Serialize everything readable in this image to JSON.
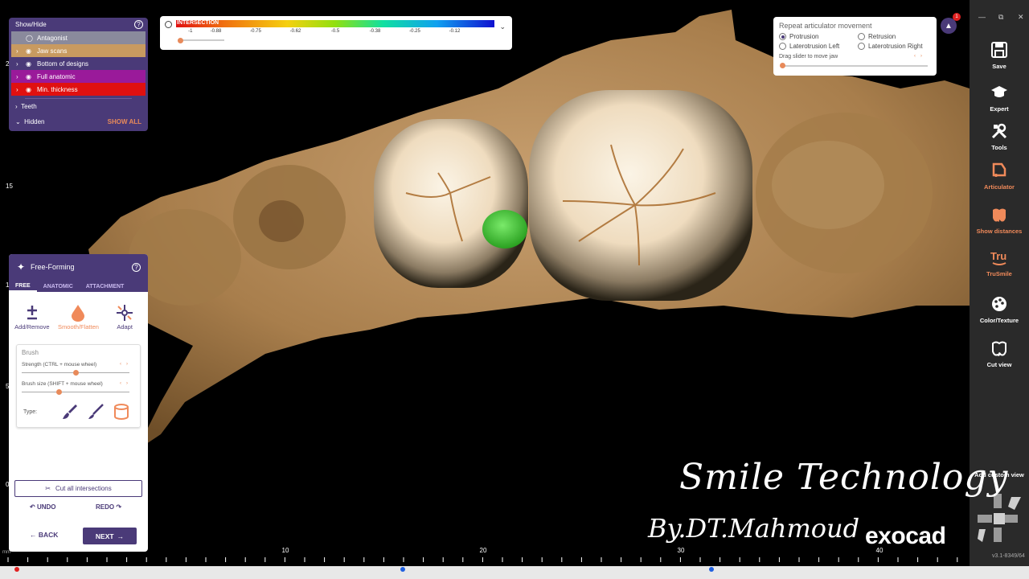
{
  "colors": {
    "panel_purple": "#4a3a78",
    "accent_orange": "#f08a5a",
    "antagonist_row": "#8a8a9c",
    "jaw_scans_row": "#c89a60",
    "full_anatomic_row": "#9a1a9a",
    "min_thickness_row": "#e01010",
    "intersection_highlight": "#3cc030"
  },
  "show_hide": {
    "title": "Show/Hide",
    "items": [
      {
        "label": "Antagonist"
      },
      {
        "label": "Jaw scans"
      },
      {
        "label": "Bottom of designs"
      },
      {
        "label": "Full anatomic"
      },
      {
        "label": "Min. thickness"
      }
    ],
    "teeth_label": "Teeth",
    "hidden_label": "Hidden",
    "show_all_label": "SHOW ALL"
  },
  "intersection": {
    "title": "INTERSECTION",
    "ticks": [
      "-1",
      "-0.88",
      "-0.75",
      "-0.62",
      "-0.5",
      "-0.38",
      "-0.25",
      "-0.12"
    ],
    "slider_value": 0.05
  },
  "articulator": {
    "title": "Repeat articulator movement",
    "options": [
      {
        "label": "Protrusion",
        "selected": true
      },
      {
        "label": "Retrusion",
        "selected": false
      },
      {
        "label": "Laterotrusion Left",
        "selected": false
      },
      {
        "label": "Laterotrusion Right",
        "selected": false
      }
    ],
    "drag_hint": "Drag slider to move jaw",
    "slider_value": 0.0
  },
  "notifications": {
    "count": "1"
  },
  "toolbar": {
    "items": [
      {
        "label": "Save",
        "icon": "save-icon"
      },
      {
        "label": "Expert",
        "icon": "graduation-cap-icon"
      },
      {
        "label": "Tools",
        "icon": "tools-icon"
      },
      {
        "label": "Articulator",
        "icon": "articulator-icon"
      },
      {
        "label": "Show distances",
        "icon": "distances-icon"
      },
      {
        "label": "TruSmile",
        "icon": "trusmile-icon"
      },
      {
        "label": "Color/Texture",
        "icon": "palette-icon"
      },
      {
        "label": "Cut view",
        "icon": "cut-view-icon"
      }
    ],
    "custom_view_label": "Add custom view",
    "version": "v3.1-8349/64"
  },
  "free_forming": {
    "title": "Free-Forming",
    "tabs": [
      "FREE",
      "ANATOMIC",
      "ATTACHMENT"
    ],
    "tools": [
      {
        "label": "Add/Remove"
      },
      {
        "label": "Smooth/Flatten"
      },
      {
        "label": "Adapt"
      }
    ],
    "brush_title": "Brush",
    "strength_label": "Strength (CTRL + mouse wheel)",
    "strength_value": 0.5,
    "size_label": "Brush size (SHIFT + mouse wheel)",
    "size_value": 0.35,
    "type_label": "Type:",
    "cut_label": "Cut all intersections",
    "undo_label": "UNDO",
    "redo_label": "REDO",
    "back_label": "BACK",
    "next_label": "NEXT"
  },
  "ruler": {
    "unit": "mm",
    "labels": [
      "10",
      "20",
      "30",
      "40"
    ],
    "left_labels": [
      "2",
      "15",
      "1",
      "5",
      "0"
    ]
  },
  "watermark": {
    "line1": "Smile Technology",
    "line2": "By.DT.Mahmoud",
    "brand": "exocad"
  }
}
